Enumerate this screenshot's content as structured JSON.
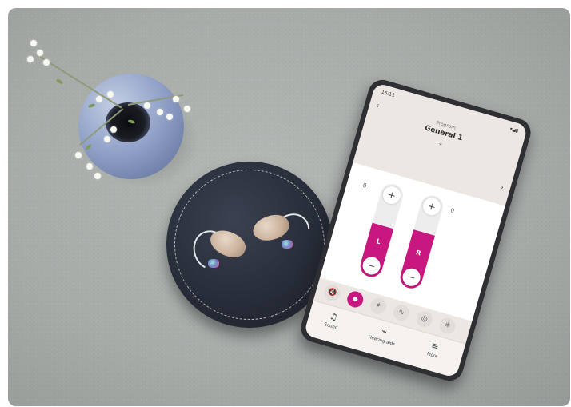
{
  "app": {
    "status_time": "16:11",
    "status_icons": "▾◢▮",
    "program_label": "Program",
    "program_name": "General 1",
    "sliders": {
      "left": {
        "letter": "L",
        "value": "0",
        "level": 0.55
      },
      "right": {
        "letter": "R",
        "value": "0",
        "level": 0.6
      }
    },
    "quick_buttons": [
      "🔇",
      "◆",
      "♯",
      "∿",
      "◎",
      "✳"
    ],
    "nav": [
      {
        "icon": "♫",
        "label": "Sound"
      },
      {
        "icon": "⌁",
        "label": "Hearing aids"
      },
      {
        "icon": "≡",
        "label": "More"
      }
    ]
  },
  "colors": {
    "accent": "#c8177f",
    "carpet": "#a6aba8",
    "vase": "#93a3c9",
    "mat": "#262b37"
  }
}
